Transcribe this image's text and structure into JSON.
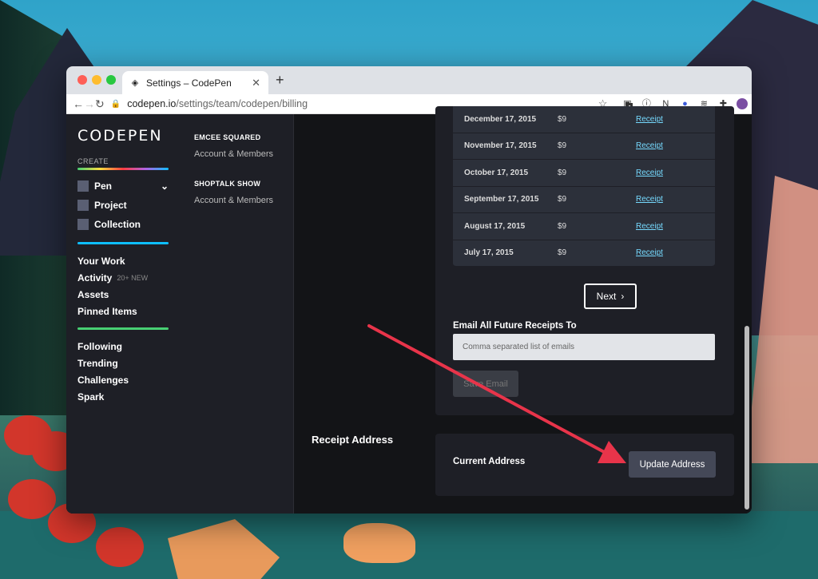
{
  "browser": {
    "tab_title": "Settings – CodePen",
    "tab_close": "✕",
    "new_tab": "+",
    "url_host": "codepen.io",
    "url_path": "/settings/team/codepen/billing",
    "ext_badge": "1"
  },
  "sidebar": {
    "logo": "CODEPEN",
    "create_label": "CREATE",
    "create_items": [
      {
        "label": "Pen"
      },
      {
        "label": "Project"
      },
      {
        "label": "Collection"
      }
    ],
    "nav_main": [
      {
        "label": "Your Work"
      },
      {
        "label": "Activity",
        "badge": "20+ NEW"
      },
      {
        "label": "Assets"
      },
      {
        "label": "Pinned Items"
      }
    ],
    "nav_social": [
      {
        "label": "Following"
      },
      {
        "label": "Trending"
      },
      {
        "label": "Challenges"
      },
      {
        "label": "Spark"
      }
    ]
  },
  "teams": [
    {
      "name": "EMCEE SQUARED",
      "link": "Account & Members"
    },
    {
      "name": "SHOPTALK SHOW",
      "link": "Account & Members"
    }
  ],
  "receipts": [
    {
      "date": "December 17, 2015",
      "amount": "$9",
      "link": "Receipt"
    },
    {
      "date": "November 17, 2015",
      "amount": "$9",
      "link": "Receipt"
    },
    {
      "date": "October 17, 2015",
      "amount": "$9",
      "link": "Receipt"
    },
    {
      "date": "September 17, 2015",
      "amount": "$9",
      "link": "Receipt"
    },
    {
      "date": "August 17, 2015",
      "amount": "$9",
      "link": "Receipt"
    },
    {
      "date": "July 17, 2015",
      "amount": "$9",
      "link": "Receipt"
    }
  ],
  "pagination": {
    "next_label": "Next"
  },
  "email": {
    "label": "Email All Future Receipts To",
    "placeholder": "Comma separated list of emails",
    "save_label": "Save Email"
  },
  "address": {
    "section_title": "Receipt Address",
    "current_label": "Current Address",
    "update_label": "Update Address"
  },
  "colors": {
    "annotation_arrow": "#e8344a",
    "link": "#76daff",
    "page_bg": "#131417"
  }
}
